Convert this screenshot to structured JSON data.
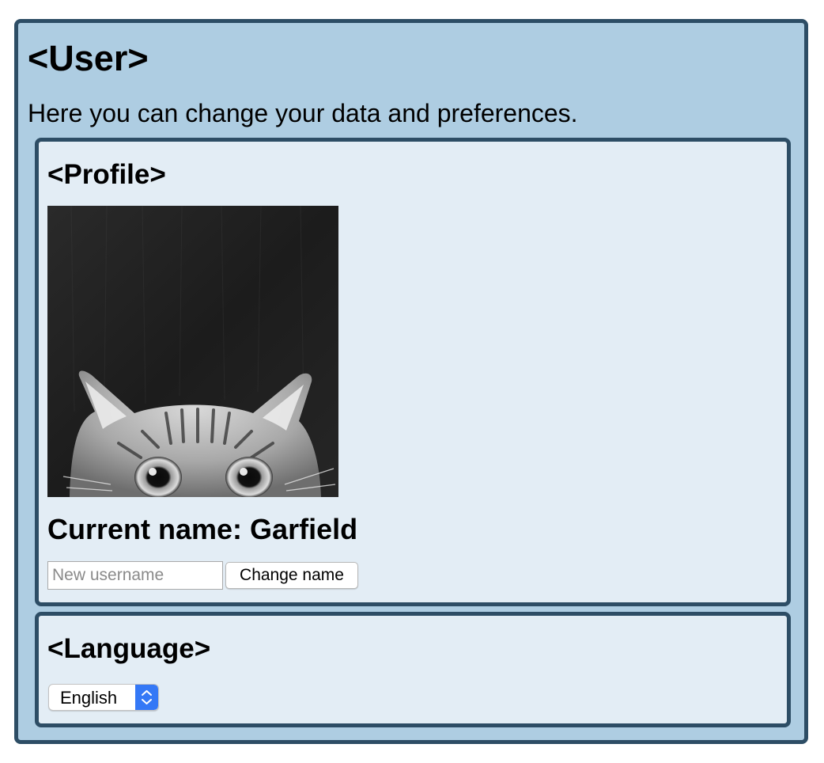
{
  "user": {
    "title": "<User>",
    "description": "Here you can change your data and preferences."
  },
  "profile": {
    "title": "<Profile>",
    "avatar_alt": "cat-peeking-photo",
    "current_name_label": "Current name: Garfield",
    "username_input": {
      "value": "",
      "placeholder": "New username"
    },
    "change_button_label": "Change name"
  },
  "language": {
    "title": "<Language>",
    "selected": "English",
    "accent_color": "#3478f6"
  },
  "colors": {
    "outer_panel": "#aecde2",
    "inner_card": "#e3edf5",
    "border": "#2d4d65"
  }
}
